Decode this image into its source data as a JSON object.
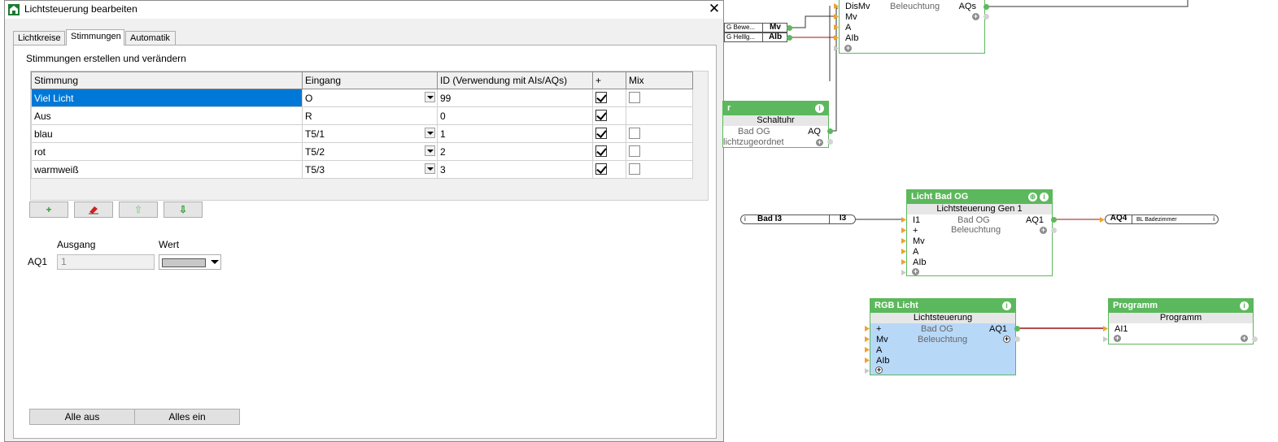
{
  "dialog": {
    "title": "Lichtsteuerung bearbeiten",
    "close_glyph": "✕",
    "tabs": [
      {
        "label": "Lichtkreise"
      },
      {
        "label": "Stimmungen"
      },
      {
        "label": "Automatik"
      }
    ],
    "section_label": "Stimmungen erstellen und verändern",
    "grid": {
      "headers": [
        "Stimmung",
        "Eingang",
        "ID (Verwendung mit AIs/AQs)",
        "+",
        "Mix"
      ],
      "rows": [
        {
          "stimmung": "Viel Licht",
          "eingang": "O",
          "id": "99",
          "plus": true,
          "mix": false,
          "has_dropdown": true,
          "has_mix": true,
          "selected": true
        },
        {
          "stimmung": "Aus",
          "eingang": "R",
          "id": "0",
          "plus": true,
          "mix": false,
          "has_dropdown": false,
          "has_mix": false,
          "selected": false
        },
        {
          "stimmung": "blau",
          "eingang": "T5/1",
          "id": "1",
          "plus": true,
          "mix": false,
          "has_dropdown": true,
          "has_mix": true,
          "selected": false
        },
        {
          "stimmung": "rot",
          "eingang": "T5/2",
          "id": "2",
          "plus": true,
          "mix": false,
          "has_dropdown": true,
          "has_mix": true,
          "selected": false
        },
        {
          "stimmung": "warmweiß",
          "eingang": "T5/3",
          "id": "3",
          "plus": true,
          "mix": false,
          "has_dropdown": true,
          "has_mix": true,
          "selected": false
        }
      ]
    },
    "toolbar": {
      "add": "+",
      "up": "⇧",
      "down": "⇩"
    },
    "ausgang_label": "Ausgang",
    "wert_label": "Wert",
    "aq1_label": "AQ1",
    "aq1_value": "1",
    "wert_color": "#c8c8c8",
    "buttons": {
      "alle_aus": "Alle aus",
      "alles_ein": "Alles ein"
    }
  },
  "diagram": {
    "top_block": {
      "inputs": [
        "DisMv",
        "Mv",
        "A",
        "AIb"
      ],
      "title": "Beleuchtung",
      "output": "AQs"
    },
    "mini_refs": [
      {
        "left": "G Bewe...",
        "right": "Mv"
      },
      {
        "left": "G Helllg...",
        "right": "AIb"
      }
    ],
    "schaltuhr": {
      "title": "r",
      "sub": "Schaltuhr",
      "line1": "Bad OG",
      "out": "AQ",
      "line2": "lichtzugeordnet"
    },
    "licht_bad_og": {
      "title": "Licht Bad OG",
      "sub": "Lichtsteuerung Gen 1",
      "inputs": [
        "I1",
        "+",
        "Mv",
        "A",
        "AIb"
      ],
      "center1": "Bad OG",
      "center2": "Beleuchtung",
      "output": "AQ1"
    },
    "bad_i3": {
      "left": "Bad I3",
      "right": "I3"
    },
    "aq4": {
      "left": "AQ4",
      "right": "BL Badezimmer"
    },
    "rgb_licht": {
      "title": "RGB Licht",
      "sub": "Lichtsteuerung",
      "inputs": [
        "+",
        "Mv",
        "A",
        "AIb"
      ],
      "center1": "Bad OG",
      "center2": "Beleuchtung",
      "output": "AQ1"
    },
    "programm": {
      "title": "Programm",
      "sub": "Programm",
      "input": "AI1"
    },
    "colors": {
      "block_green": "#5cb85c",
      "selected_fill": "#b8d8f8",
      "wire_red": "#a01010"
    }
  }
}
